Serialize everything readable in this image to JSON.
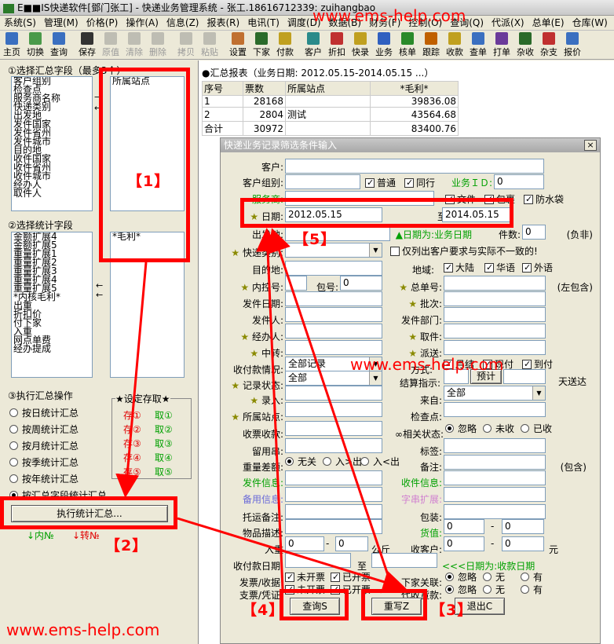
{
  "app": {
    "title": "E■■IS快递软件[鄧门张工] - 快递业务管理系统 - 张工.18616712339: zuihangbao",
    "watermark": "www.ems-help.com"
  },
  "menu": [
    "系统(S)",
    "管理(M)",
    "价格(P)",
    "操作(A)",
    "信息(Z)",
    "报表(R)",
    "电讯(T)",
    "调度(D)",
    "数据(B)",
    "财务(F)",
    "控制(O)",
    "查询(Q)",
    "代派(X)",
    "总单(E)",
    "仓库(W)"
  ],
  "toolbar": [
    "主页",
    "切换",
    "查询",
    "保存",
    "原值",
    "清除",
    "删除",
    "拷贝",
    "粘贴",
    "设置",
    "下家",
    "付款",
    "客户",
    "折扣",
    "快录",
    "业务",
    "核单",
    "跟踪",
    "收款",
    "查单",
    "打单",
    "杂收",
    "杂支",
    "报价"
  ],
  "left": {
    "section1": "①选择汇总字段（最多3个）",
    "fields1": [
      "客户组别",
      "检查点",
      "服务商名称",
      "快递类别",
      "出发地",
      "发件国家",
      "发件省州",
      "发件城市",
      "目的地",
      "收件国家",
      "收件省州",
      "收件城市",
      "经办人",
      "取件人"
    ],
    "selected1": "所属站点",
    "section2": "②选择统计字段",
    "fields2": [
      "金额扩展4",
      "金额扩展5",
      "重量扩展1",
      "重量扩展2",
      "重量扩展3",
      "重量扩展4",
      "重量扩展5",
      "*内核毛利*",
      "出重",
      "折扣价",
      "付下家",
      "入重",
      "网点单费",
      "经办提成"
    ],
    "selected2": "*毛利*",
    "section3": "③执行汇总操作",
    "radios": [
      "按日统计汇总",
      "按周统计汇总",
      "按月统计汇总",
      "按季统计汇总",
      "按年统计汇总",
      "按汇总字段统计汇总"
    ],
    "save_title": "★设定存取★",
    "store": [
      "存①",
      "存②",
      "存③",
      "存④",
      "存⑤"
    ],
    "fetch": [
      "取①",
      "取②",
      "取③",
      "取④",
      "取⑤"
    ],
    "exec_button": "执行统计汇总...",
    "inner": "↓内№",
    "transfer": "↓转№"
  },
  "report": {
    "title": "●汇总报表（业务日期: 2012.05.15-2014.05.15 ...）",
    "headers": [
      "序号",
      "票数",
      "所属站点",
      "*毛利*"
    ],
    "rows": [
      [
        "1",
        "28168",
        "",
        "39836.08"
      ],
      [
        "2",
        "2804",
        "测试",
        "43564.68"
      ],
      [
        "合计",
        "30972",
        "",
        "83400.76"
      ]
    ]
  },
  "dialog": {
    "title": "快递业务记录筛选条件输入",
    "close": "×",
    "labels": {
      "customer": "客户:",
      "customer_group": "客户组别:",
      "service": "服务商:",
      "date": "日期:",
      "origin": "出发地:",
      "express_type": "快递类别:",
      "dest": "目的地:",
      "inner_no": "内控号:",
      "pack_no": "包号:",
      "sender_date": "发件日期:",
      "sender": "发件人:",
      "handler": "经办人:",
      "transfer": "中转:",
      "collect_pay": "收付款情况:",
      "rec_status": "记录状态:",
      "entry": "录入:",
      "station": "所属站点:",
      "receipt": "收票收款:",
      "leave_str": "留用串:",
      "weight_diff": "重量差额:",
      "sender_info": "发件信息:",
      "backup_info": "备用信息:",
      "ship_note": "托运备注:",
      "goods_desc": "物品描述:",
      "in_weight": "入重",
      "kg": "公斤",
      "pay_date": "收付款日期:",
      "to": "至",
      "invoice": "发票/收据:",
      "voucher": "支票/凭证:",
      "biz_id": "业务ＩＤ:",
      "count": "件数:",
      "negative": "(负非)",
      "only_mismatch": "仅列出客户要求与实际不一致的!",
      "region": "地域:",
      "master_no": "总单号:",
      "left_include": "(左包含)",
      "batch": "批次:",
      "sender_dept": "发件部门:",
      "pickup": "取件:",
      "dispatch": "派送:",
      "method": "方式:",
      "settle": "结算指示:",
      "prepay": "预计",
      "days_arrive": "天送达",
      "from": "来自:",
      "checkpoint": "检查点:",
      "related": "∞相关状态:",
      "tag": "标签:",
      "remark": "备注:",
      "contain": "(包含)",
      "receiver_info": "收件信息:",
      "str_ext": "字串扩展:",
      "packing": "包装:",
      "value": "货值:",
      "receiver": "收客户:",
      "yuan": "元",
      "downstream": "下家关联:",
      "cod": "代收货款:",
      "date_biz": "▲日期为:业务日期",
      "date_pay": "<<<日期为:收款日期"
    },
    "values": {
      "biz_id": "0",
      "date_from": "2012.05.15",
      "date_to": "2014.05.15",
      "count": "0",
      "pack_no": "0",
      "collect": "全部记录",
      "status": "全部",
      "from": "全部",
      "num0": "0"
    },
    "checks": {
      "normal": "普通",
      "peer": "同行",
      "doc": "文件",
      "parcel": "包裹",
      "waterproof": "防水袋",
      "mainland": "大陆",
      "chinese": "华语",
      "foreign": "外语",
      "monthly": "月结",
      "cash": "现付",
      "cod_pay": "到付"
    },
    "radios": {
      "none": "无关",
      "in_out": "入>出",
      "out_in": "入<出",
      "ignore": "忽略",
      "unreceived": "未收",
      "received": "已收",
      "not_issued": "未开票",
      "issued": "已开票",
      "none2": "无",
      "yes": "有"
    },
    "buttons": {
      "query": "查询S",
      "rewrite": "重写Z",
      "exit": "退出C"
    }
  },
  "annotations": {
    "tag1": "【1】",
    "tag2": "【2】",
    "tag3": "【3】",
    "tag4": "【4】",
    "tag5": "【5】"
  },
  "colors": {
    "annotation": "#ff0000",
    "green": "#00a000"
  }
}
